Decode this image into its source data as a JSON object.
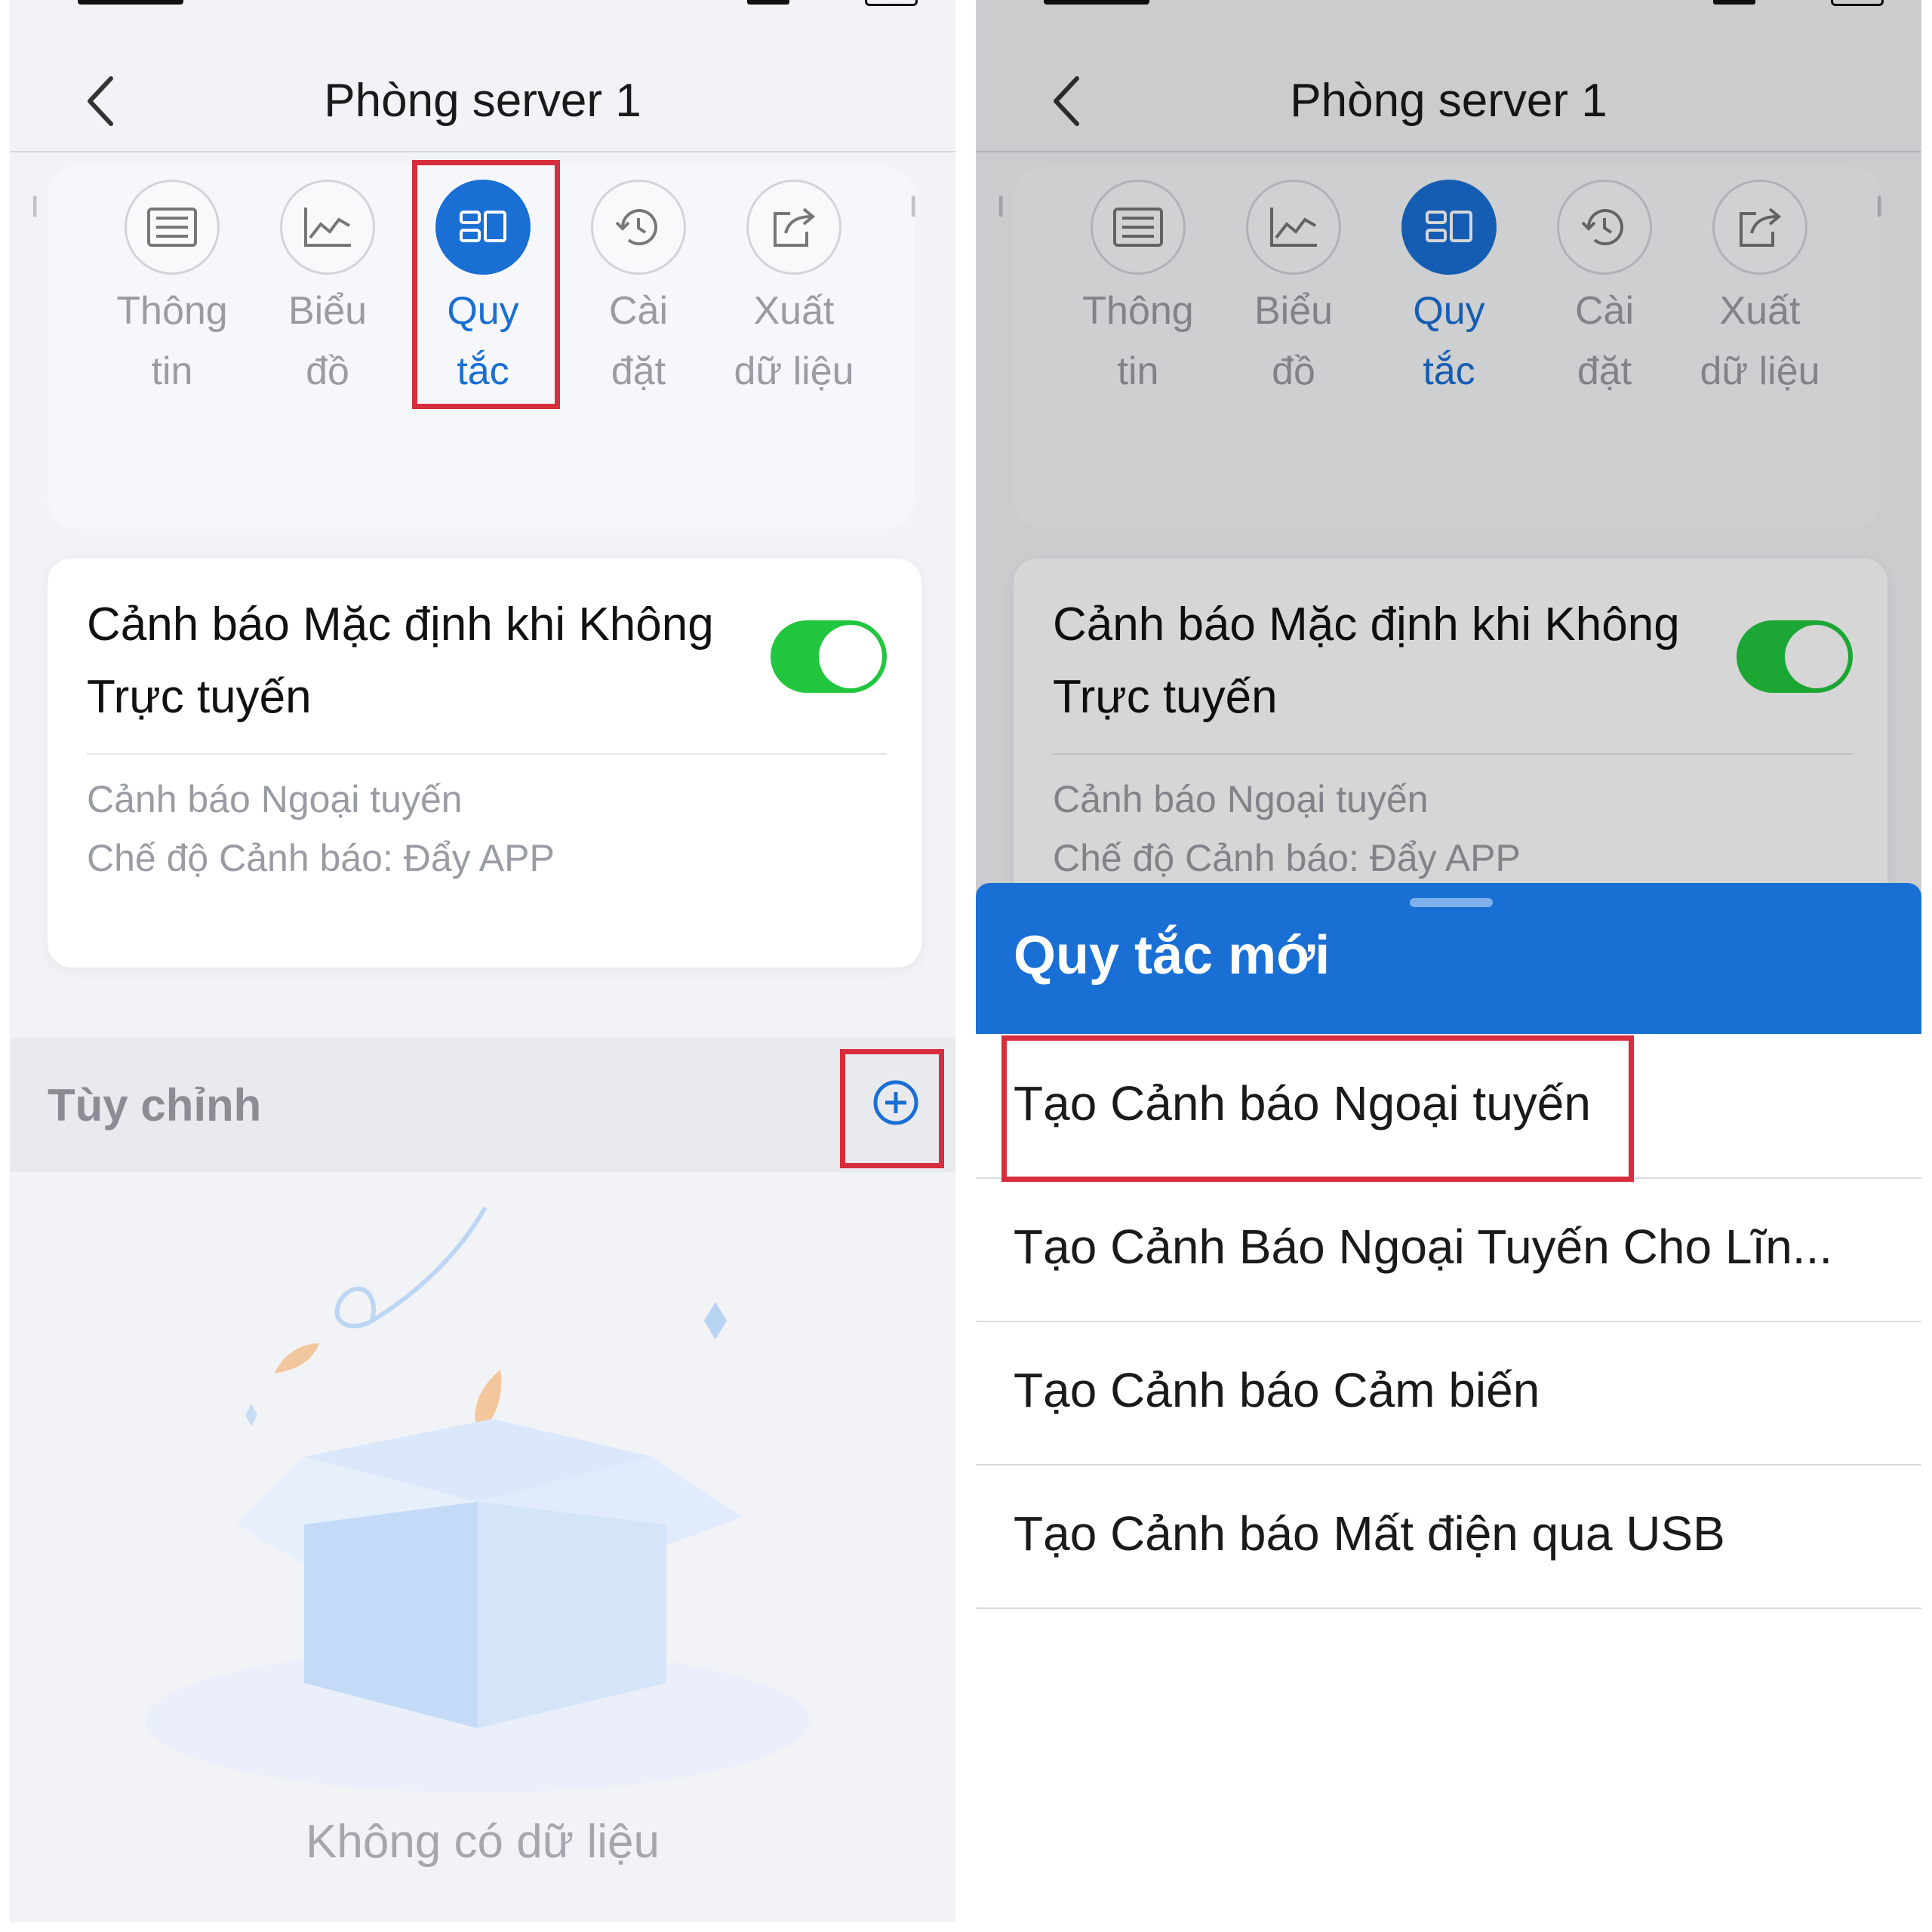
{
  "screen": {
    "title": "Phòng server 1",
    "tabs": [
      {
        "line1": "Thông",
        "line2": "tin",
        "icon": "list-icon",
        "active": false
      },
      {
        "line1": "Biểu",
        "line2": "đồ",
        "icon": "chart-icon",
        "active": false
      },
      {
        "line1": "Quy",
        "line2": "tắc",
        "icon": "rules-icon",
        "active": true
      },
      {
        "line1": "Cài",
        "line2": "đặt",
        "icon": "history-settings-icon",
        "active": false
      },
      {
        "line1": "Xuất",
        "line2": "dữ liệu",
        "icon": "export-icon",
        "active": false
      }
    ],
    "default_alert": {
      "title": "Cảnh báo Mặc định khi Không Trực tuyến",
      "enabled": true,
      "type_text": "Cảnh báo Ngoại tuyến",
      "mode_text": "Chế độ Cảnh báo: Đẩy APP"
    },
    "custom": {
      "label": "Tùy chỉnh"
    },
    "empty_text": "Không có dữ liệu"
  },
  "sheet": {
    "title": "Quy tắc mới",
    "items": [
      "Tạo Cảnh báo Ngoại tuyến",
      "Tạo Cảnh Báo Ngoại Tuyến Cho Lĩn...",
      "Tạo Cảnh báo Cảm biến",
      "Tạo Cảnh báo Mất điện qua USB"
    ]
  },
  "colors": {
    "accent": "#1a6fd4",
    "toggle_on": "#22c63e",
    "highlight": "#d62e3c",
    "muted_text": "#9a9ca4"
  }
}
